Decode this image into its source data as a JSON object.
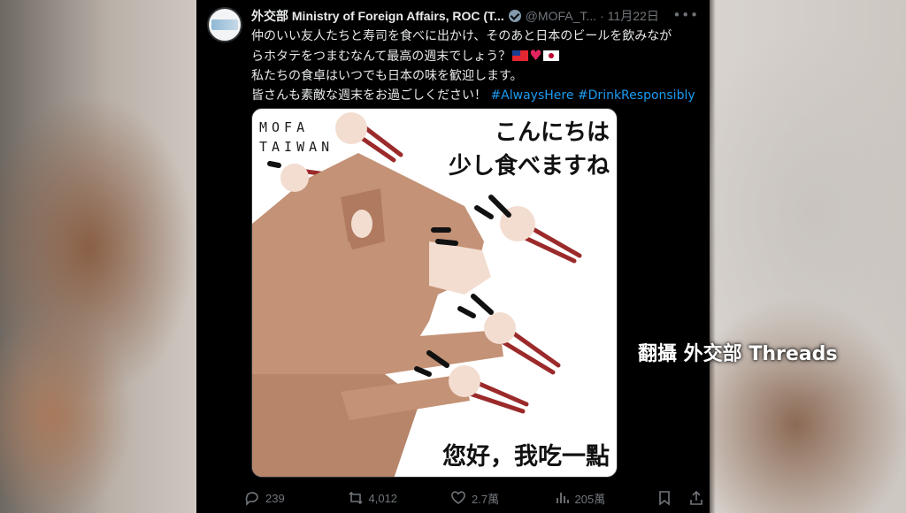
{
  "post": {
    "author_name": "外交部 Ministry of Foreign Affairs, ROC (T...",
    "handle": "@MOFA_T...",
    "separator": "·",
    "date": "11月22日",
    "more_icon": "more-horizontal-icon",
    "text_lines": [
      "仲のいい友人たちと寿司を食べに出かけ、そのあと日本のビールを飲みなが",
      "らホタテをつまむなんて最高の週末でしょう？",
      "私たちの食卓はいつでも日本の味を歓迎します。",
      "皆さんも素敵な週末をお過ごしください！"
    ],
    "hashtags": [
      "#AlwaysHere",
      "#DrinkResponsibly"
    ]
  },
  "media": {
    "logo_line1": "MOFA",
    "logo_line2": "TAIWAN",
    "jp_caption_line1": "こんにちは",
    "jp_caption_line2": "少し食べますね",
    "zh_caption": "您好，我吃一點",
    "colors": {
      "cat_fur": "#c49276",
      "cat_light": "#f3ddd0",
      "chopsticks": "#9b2a2a"
    }
  },
  "actions": {
    "replies": "239",
    "reposts": "4,012",
    "likes": "2.7萬",
    "views": "205萬",
    "icons": [
      "reply-icon",
      "repost-icon",
      "like-icon",
      "views-icon",
      "bookmark-icon",
      "share-icon"
    ]
  },
  "watermark": "翻攝 外交部 Threads"
}
